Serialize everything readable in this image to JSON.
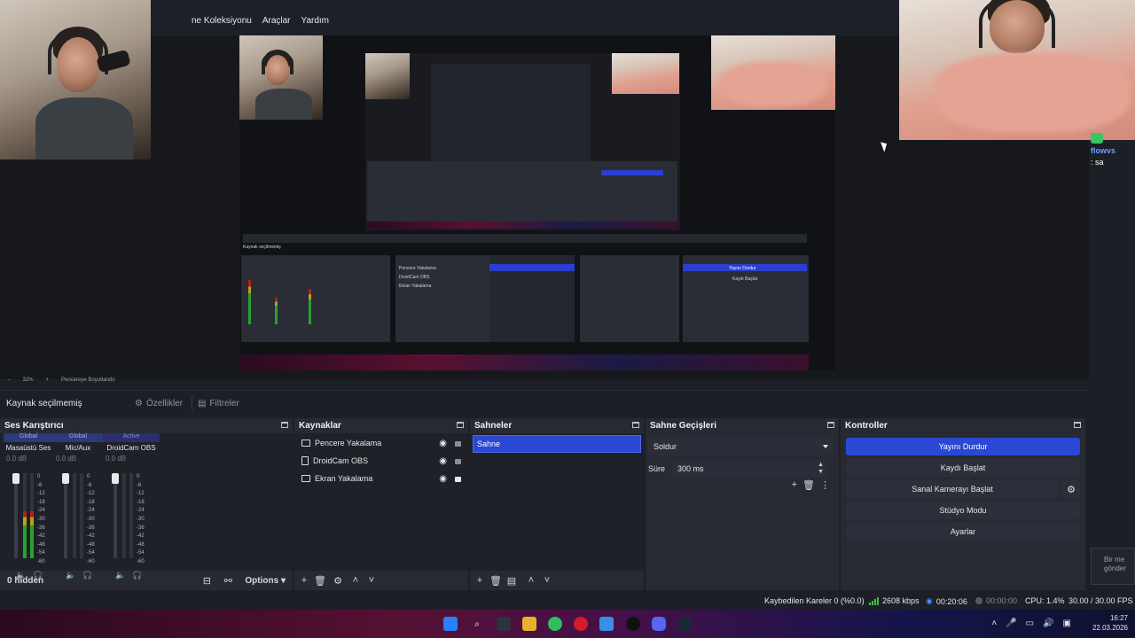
{
  "menu": {
    "items": [
      "ne Koleksiyonu",
      "Araçlar",
      "Yardım"
    ]
  },
  "zoom": {
    "level": "32%",
    "fit": "Pencereye Boyutlandır"
  },
  "chat": {
    "user": "flowvs",
    "message": ": sa"
  },
  "source_bar": {
    "no_selection": "Kaynak seçilmemiş",
    "properties": "Özellikler",
    "filters": "Filtreler"
  },
  "mixer": {
    "title": "Ses Karıştırıcı",
    "hidden": "0 hidden",
    "options": "Options",
    "scale": [
      "0",
      "-6",
      "-12",
      "-18",
      "-24",
      "-30",
      "-36",
      "-42",
      "-48",
      "-54",
      "-60"
    ],
    "channels": [
      {
        "tag": "Global",
        "name": "Masaüstü Ses",
        "db": "0.0 dB",
        "level": 0.55
      },
      {
        "tag": "Global",
        "name": "Mic/Aux",
        "db": "0.0 dB",
        "level": 0.0
      },
      {
        "tag": "Active",
        "name": "DroidCam OBS",
        "db": "0.0 dB",
        "level": 0.0
      }
    ],
    "colors": {
      "green": "#2aa030",
      "yellow": "#b8a020",
      "red": "#b02020"
    }
  },
  "sources": {
    "title": "Kaynaklar",
    "items": [
      {
        "name": "Pencere Yakalama",
        "locked": false
      },
      {
        "name": "DroidCam OBS",
        "locked": false
      },
      {
        "name": "Ekran Yakalama",
        "locked": true
      }
    ]
  },
  "scenes": {
    "title": "Sahneler",
    "items": [
      "Sahne"
    ]
  },
  "transitions": {
    "title": "Sahne Geçişleri",
    "selected": "Soldur",
    "duration_label": "Süre",
    "duration": "300 ms"
  },
  "controls": {
    "title": "Kontroller",
    "buttons": [
      "Yayını Durdur",
      "Kaydı Başlat",
      "Sanal Kamerayı Başlat",
      "Stüdyo Modu",
      "Ayarlar"
    ],
    "accent": "#2b48d4"
  },
  "status": {
    "dropped": "Kaybedilen Kareler 0 (%0.0)",
    "bitrate": "2608 kbps",
    "stream_time": "00:20:06",
    "rec_time": "00:00:00",
    "cpu": "CPU: 1.4%",
    "fps": "30.00 / 30.00 FPS"
  },
  "taskbar": {
    "time": "16:27",
    "date": "22.03.2026"
  },
  "notification": {
    "text": "Bir me gönder"
  }
}
